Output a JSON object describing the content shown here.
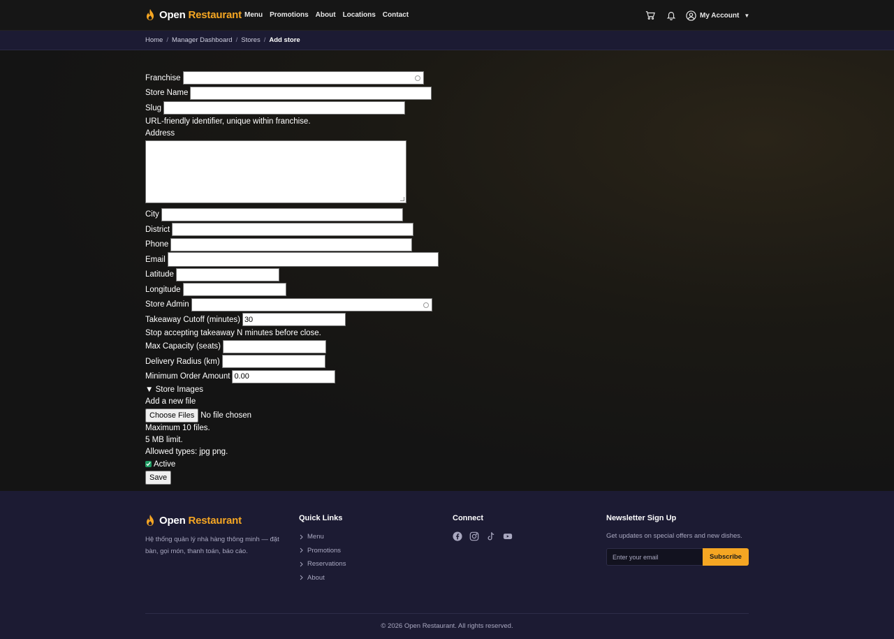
{
  "header": {
    "brand_open": "Open",
    "brand_restaurant": "Restaurant",
    "nav": [
      "Menu",
      "Promotions",
      "About",
      "Locations",
      "Contact"
    ],
    "account_label": "My Account"
  },
  "breadcrumb": [
    "Home",
    "Manager Dashboard",
    "Stores",
    "Add store"
  ],
  "form": {
    "franchise_label": "Franchise",
    "store_name_label": "Store Name",
    "slug_label": "Slug",
    "slug_help": "URL-friendly identifier, unique within franchise.",
    "address_label": "Address",
    "city_label": "City",
    "district_label": "District",
    "phone_label": "Phone",
    "email_label": "Email",
    "latitude_label": "Latitude",
    "longitude_label": "Longitude",
    "store_admin_label": "Store Admin",
    "takeaway_label": "Takeaway Cutoff (minutes)",
    "takeaway_value": "30",
    "takeaway_help": "Stop accepting takeaway N minutes before close.",
    "capacity_label": "Max Capacity (seats)",
    "delivery_label": "Delivery Radius (km)",
    "min_order_label": "Minimum Order Amount",
    "min_order_value": "0.00",
    "store_images_summary": "▼ Store Images",
    "add_file_label": "Add a new file",
    "choose_files": "Choose Files",
    "no_file": "No file chosen",
    "max_files": "Maximum 10 files.",
    "size_limit": "5 MB limit.",
    "allowed_types": "Allowed types: jpg png.",
    "active_label": "Active",
    "active_checked": true,
    "save_label": "Save"
  },
  "footer": {
    "brand_open": "Open",
    "brand_restaurant": "Restaurant",
    "description": "Hệ thống quản lý nhà hàng thông minh — đặt bàn, gọi món, thanh toán, báo cáo.",
    "quick_links_title": "Quick Links",
    "quick_links": [
      "Menu",
      "Promotions",
      "Reservations",
      "About"
    ],
    "connect_title": "Connect",
    "social_icons": [
      "facebook-icon",
      "instagram-icon",
      "tiktok-icon",
      "youtube-icon"
    ],
    "newsletter_title": "Newsletter Sign Up",
    "newsletter_desc": "Get updates on special offers and new dishes.",
    "newsletter_placeholder": "Enter your email",
    "subscribe_label": "Subscribe",
    "copyright": "© 2026 Open Restaurant. All rights reserved."
  },
  "colors": {
    "accent": "#f5a623",
    "header_bg": "#161616",
    "footer_bg": "#1c1b33",
    "check_green": "#1f9c63"
  }
}
